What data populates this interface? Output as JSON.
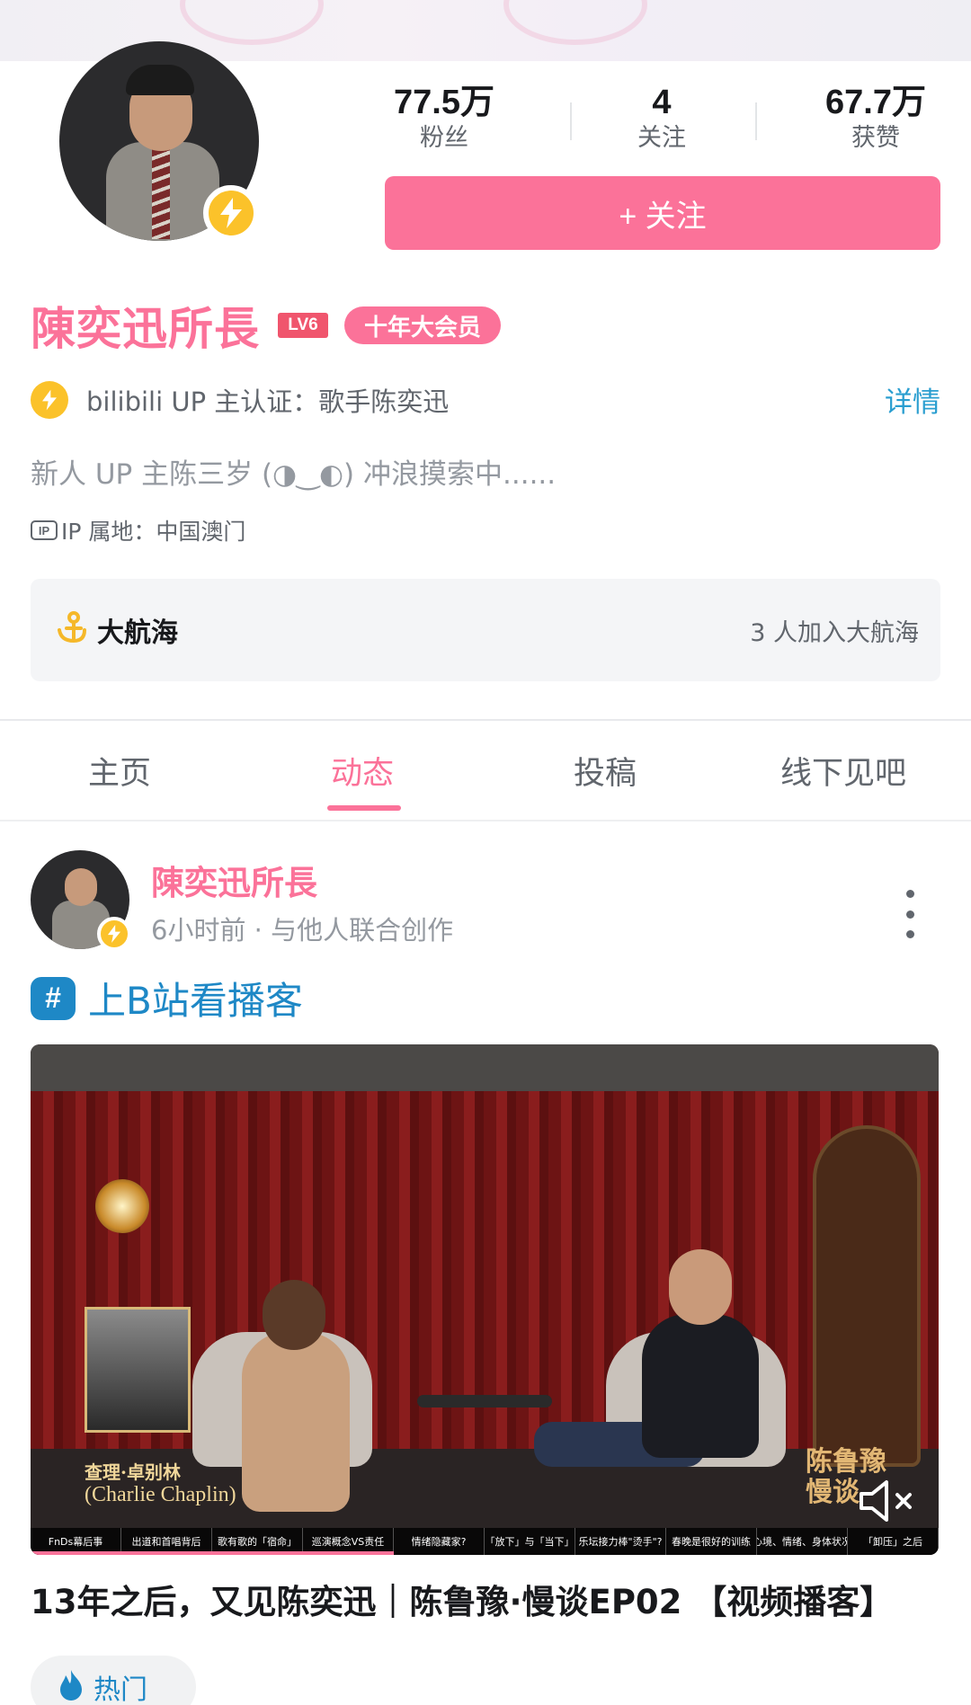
{
  "profile": {
    "stats": [
      {
        "value": "77.5万",
        "label": "粉丝"
      },
      {
        "value": "4",
        "label": "关注"
      },
      {
        "value": "67.7万",
        "label": "获赞"
      }
    ],
    "follow_button": "+ 关注",
    "name": "陳奕迅所長",
    "level": "LV6",
    "vip_badge": "十年大会员",
    "certification": "bilibili UP 主认证：歌手陈奕迅",
    "detail_link": "详情",
    "bio": "新人 UP 主陈三岁 (◑‿◐) 冲浪摸索中......",
    "ip_icon": "IP",
    "ip_location": "IP 属地：中国澳门",
    "guard": {
      "title": "大航海",
      "count": "3 人加入大航海"
    }
  },
  "tabs": [
    {
      "label": "主页"
    },
    {
      "label": "动态",
      "active": true
    },
    {
      "label": "投稿"
    },
    {
      "label": "线下见吧"
    }
  ],
  "post": {
    "author": "陳奕迅所長",
    "meta": "6小时前 · 与他人联合创作",
    "topic_icon": "#",
    "topic": "上B站看播客",
    "video": {
      "portrait_caption_cn": "查理·卓别林",
      "portrait_caption_en": "(Charlie Chaplin)",
      "show_logo": "陈鲁豫 慢谈",
      "chapters": [
        "FnDs幕后事",
        "出道和首唱背后",
        "歌有歌的「宿命」",
        "巡演概念VS责任",
        "情绪隐藏家?",
        "「放下」与「当下」",
        "乐坛接力棒\"烫手\"?",
        "春晚是很好的训练",
        "心境、情绪、身体状况",
        "「卸压」之后"
      ],
      "progress": 0.4
    },
    "title": "13年之后，又见陈奕迅｜陈鲁豫·慢谈EP02 【视频播客】",
    "tag": "热门"
  },
  "colors": {
    "accent": "#fb7299",
    "link": "#1e88c6",
    "badge": "#fbc22a"
  }
}
